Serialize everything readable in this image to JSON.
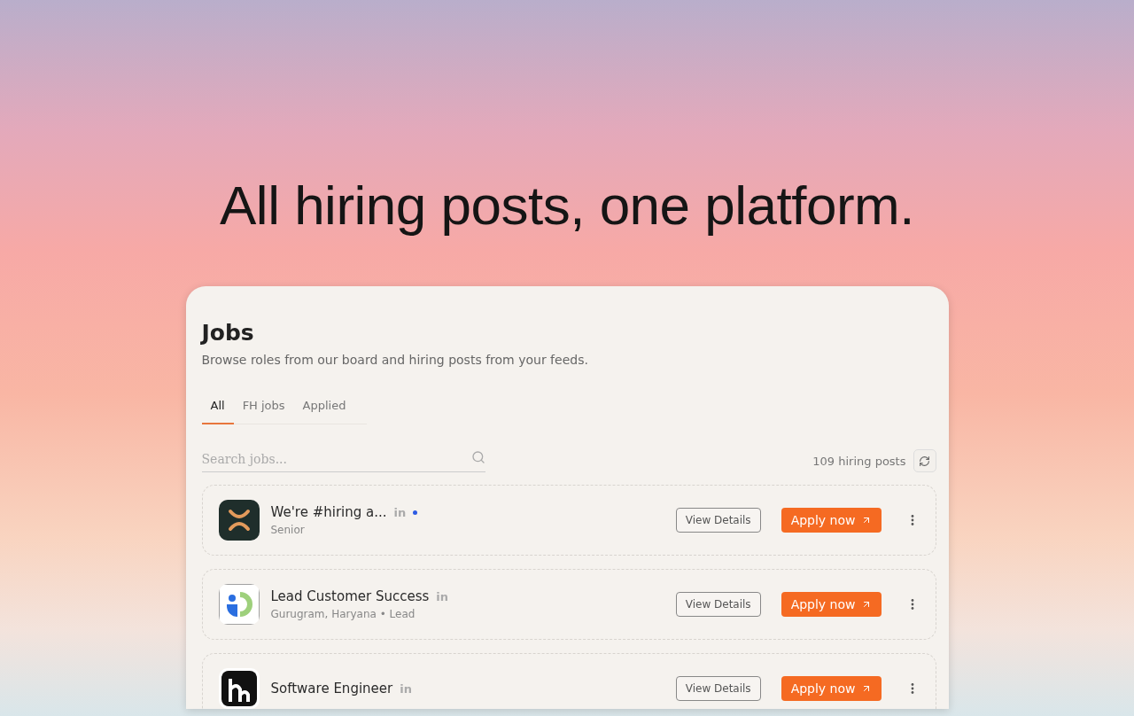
{
  "headline": "All hiring posts, one platform.",
  "panel": {
    "title": "Jobs",
    "subtitle": "Browse roles from our board and hiring posts from your feeds.",
    "tabs": [
      {
        "label": "All",
        "selected": true
      },
      {
        "label": "FH jobs",
        "selected": false
      },
      {
        "label": "Applied",
        "selected": false
      }
    ],
    "search": {
      "placeholder": "Search jobs..."
    },
    "count": "109 hiring posts",
    "jobs": [
      {
        "kind": "cross",
        "title": "We're #hiring a...",
        "meta": "Senior",
        "source_badge": "in",
        "unread": true,
        "view_label": "View Details",
        "apply_label": "Apply now"
      },
      {
        "kind": "ring",
        "title": "Lead Customer Success",
        "meta": "Gurugram, Haryana • Lead",
        "source_badge": "in",
        "unread": false,
        "view_label": "View Details",
        "apply_label": "Apply now"
      },
      {
        "kind": "hh",
        "title": "Software Engineer",
        "source_badge": "in",
        "unread": false,
        "view_label": "View Details",
        "apply_label": "Apply now"
      }
    ]
  }
}
